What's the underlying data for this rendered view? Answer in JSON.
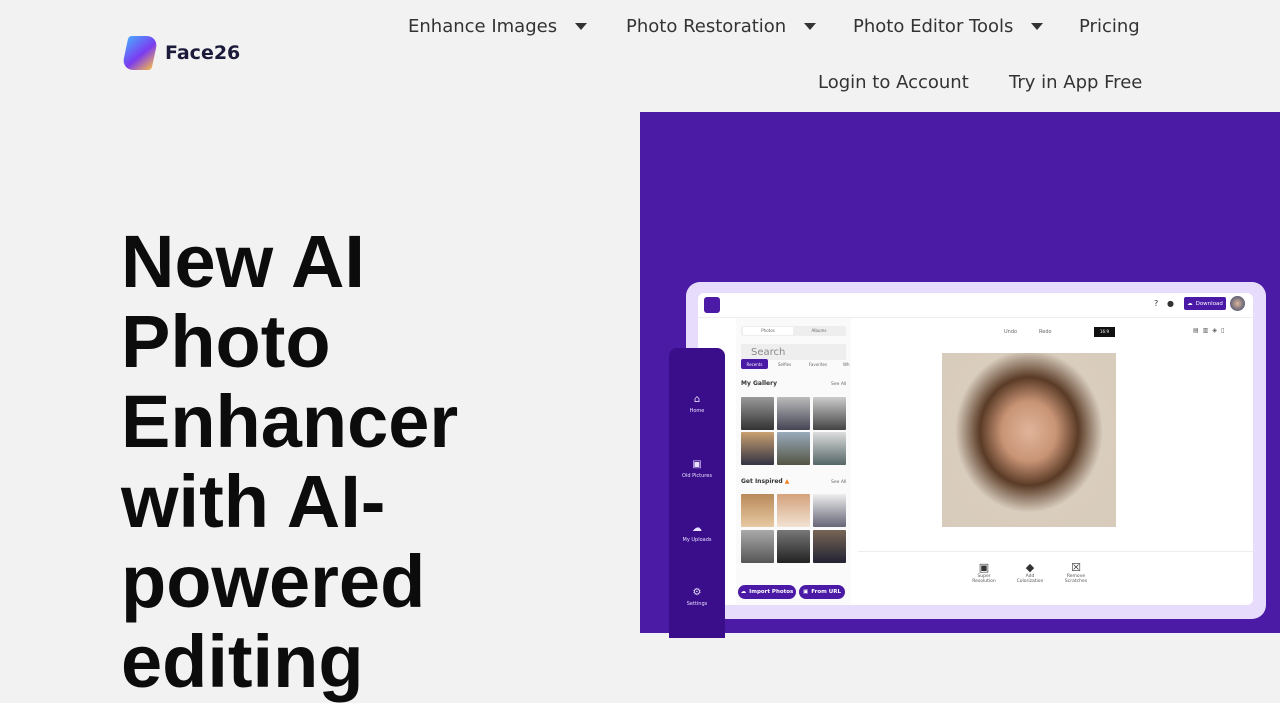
{
  "brand": {
    "name": "Face26"
  },
  "nav": {
    "items": [
      {
        "label": "Enhance Images",
        "dropdown": true
      },
      {
        "label": "Photo Restoration",
        "dropdown": true
      },
      {
        "label": "Photo Editor Tools",
        "dropdown": true
      },
      {
        "label": "Pricing"
      }
    ],
    "login": "Login to Account",
    "try": "Try in App Free"
  },
  "hero": {
    "lines": [
      "New AI",
      "Photo",
      "Enhancer",
      "with AI-",
      "powered",
      "editing"
    ]
  },
  "colors": {
    "accent": "#4b1ba6"
  },
  "app": {
    "download": "Download",
    "tabs": [
      "Photos",
      "Albums"
    ],
    "search_placeholder": "Search",
    "filters": [
      "Recents",
      "Selfies",
      "Favorites",
      "Wh"
    ],
    "gallery_title": "My Gallery",
    "see_all": "See All",
    "inspired_title": "Get Inspired",
    "undo": "Undo",
    "redo": "Redo",
    "ratio": "16:9",
    "import": "Import Photos",
    "from_url": "From URL",
    "sidebar": [
      "Home",
      "Old Pictures",
      "My Uploads",
      "Settings"
    ],
    "tools": [
      {
        "line1": "Super",
        "line2": "Resolution"
      },
      {
        "line1": "Add",
        "line2": "Colorization"
      },
      {
        "line1": "Remove",
        "line2": "Scratches"
      }
    ]
  }
}
